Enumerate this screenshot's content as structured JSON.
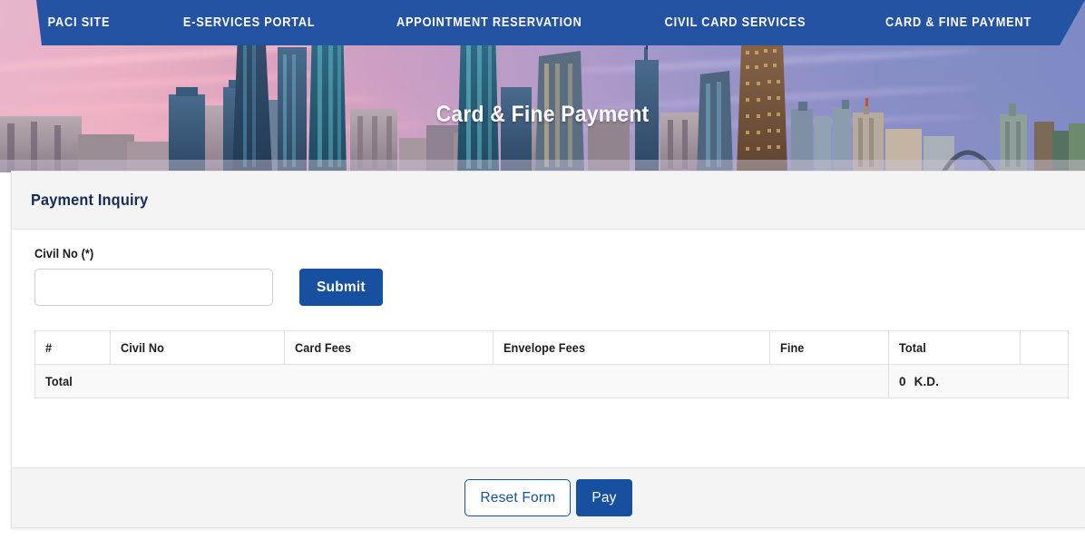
{
  "nav": {
    "items": [
      {
        "label": "PACI SITE",
        "name": "nav-item-paci-site"
      },
      {
        "label": "E-SERVICES PORTAL",
        "name": "nav-item-eservices-portal"
      },
      {
        "label": "APPOINTMENT RESERVATION",
        "name": "nav-item-appointment-reservation"
      },
      {
        "label": "CIVIL CARD SERVICES",
        "name": "nav-item-civil-card-services"
      },
      {
        "label": "CARD & FINE PAYMENT",
        "name": "nav-item-card-fine-payment"
      }
    ]
  },
  "hero": {
    "title": "Card & Fine Payment",
    "background_description": "kuwait-city-skyline-sunset"
  },
  "panel": {
    "header_title": "Payment Inquiry"
  },
  "form": {
    "civil_no_label": "Civil No (*)",
    "civil_no_value": "",
    "civil_no_placeholder": "",
    "submit_label": "Submit"
  },
  "table": {
    "columns": [
      "#",
      "Civil No",
      "Card Fees",
      "Envelope Fees",
      "Fine",
      "Total",
      ""
    ],
    "rows": [],
    "total_row": {
      "label": "Total",
      "card_fees": "",
      "envelope_fees": "",
      "fine": "",
      "amount": "0",
      "currency": "K.D."
    }
  },
  "footer": {
    "reset_label": "Reset Form",
    "pay_label": "Pay"
  },
  "colors": {
    "nav_blue": "#2453a4",
    "button_navy": "#17509e",
    "panel_header_grey": "#f4f4f4",
    "title_navy": "#142c56",
    "table_row_grey": "#f9f9f9"
  }
}
